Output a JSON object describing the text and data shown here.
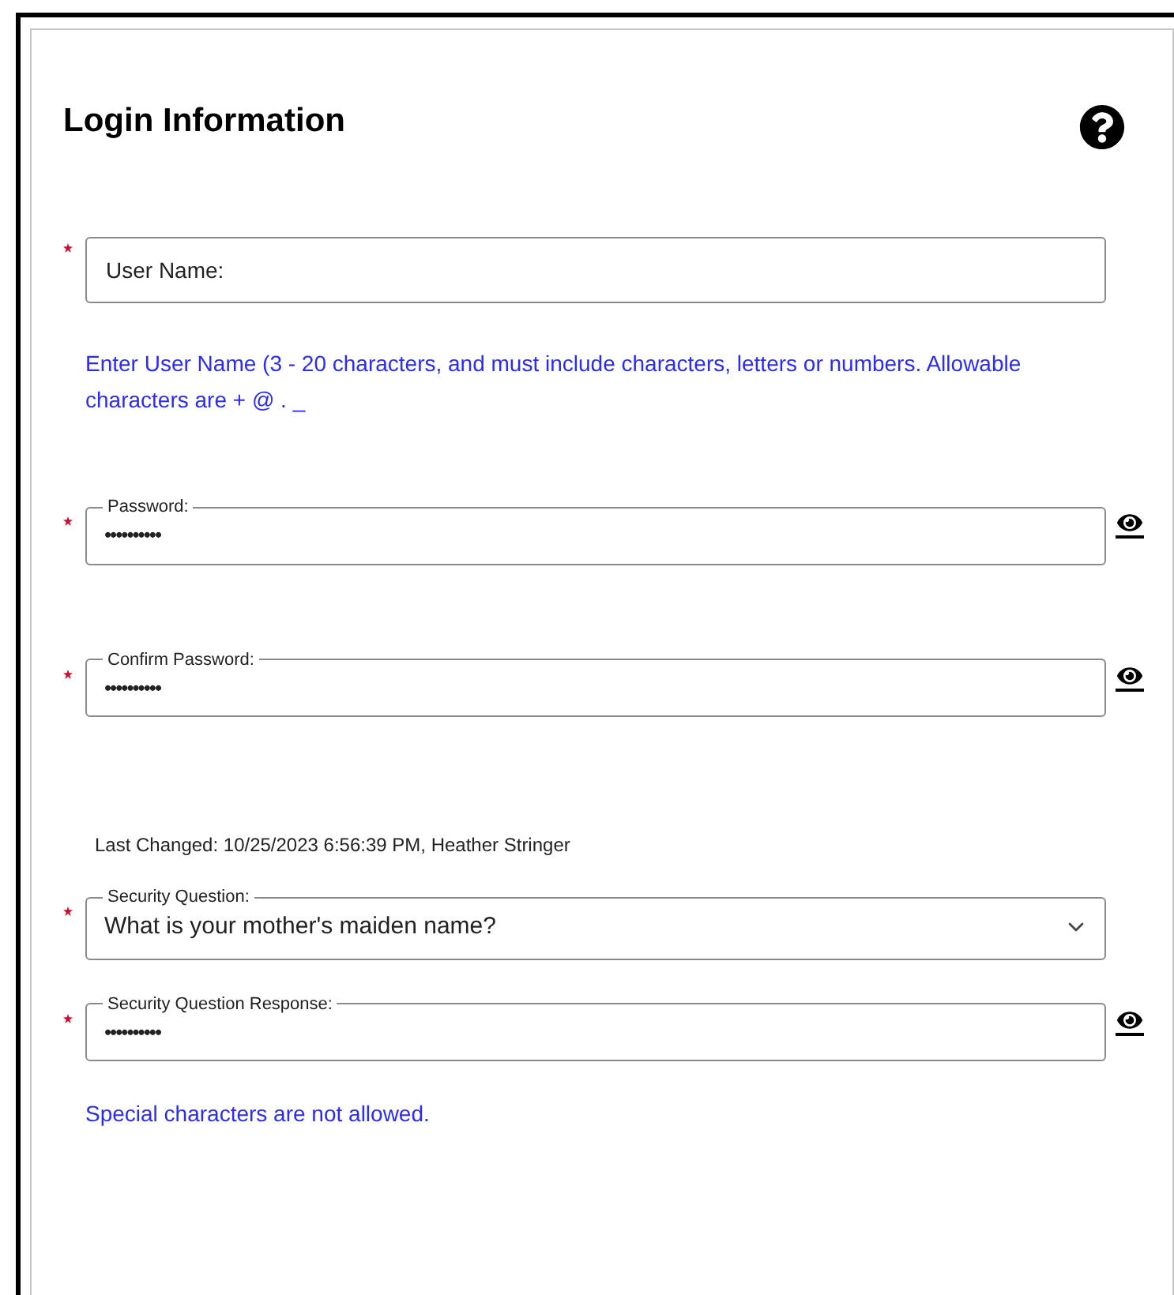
{
  "title": "Login Information",
  "items": [
    {
      "kind": "text",
      "required": true,
      "placeholder": "User Name:"
    },
    {
      "kind": "hint",
      "text": "Enter User Name (3 - 20 characters, and must include characters, letters or numbers. Allowable characters are + @ . _"
    },
    {
      "kind": "password",
      "required": true,
      "label": "Password:",
      "value": "••••••••••"
    },
    {
      "kind": "password",
      "required": true,
      "label": "Confirm Password:",
      "value": "••••••••••"
    },
    {
      "kind": "note",
      "text": "Last Changed: 10/25/2023 6:56:39 PM, Heather Stringer"
    },
    {
      "kind": "select",
      "required": true,
      "label": "Security Question:",
      "value": "What is your mother's maiden name?"
    },
    {
      "kind": "password",
      "required": true,
      "label": "Security Question Response:",
      "value": "••••••••••"
    },
    {
      "kind": "hint",
      "text": "Special characters are not allowed."
    }
  ]
}
